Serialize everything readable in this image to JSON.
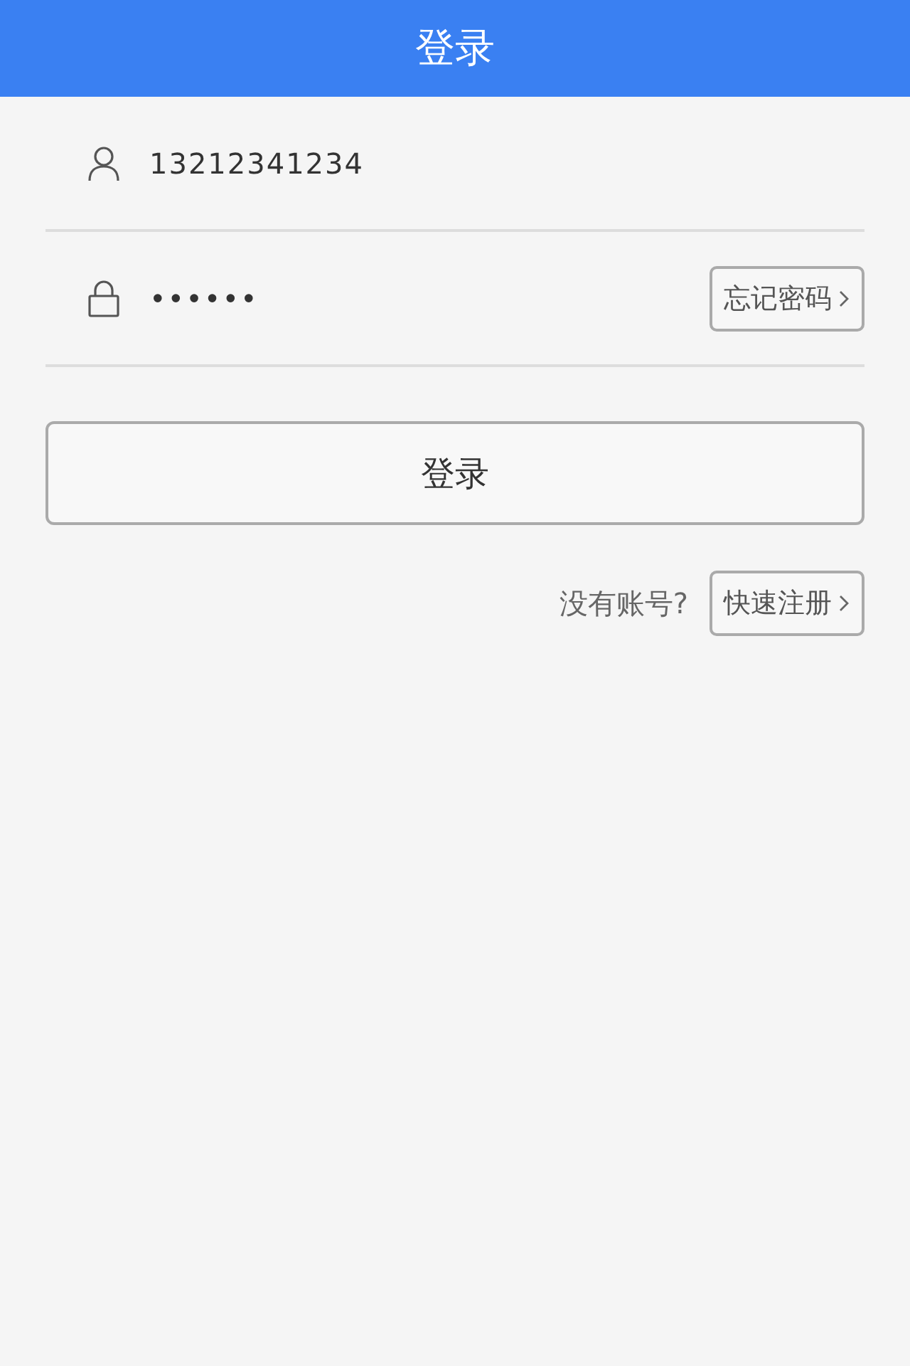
{
  "header": {
    "title": "登录"
  },
  "fields": [
    {
      "kind": "user",
      "value": "13212341234"
    },
    {
      "kind": "password",
      "value": "••••••",
      "action": "忘记密码"
    }
  ],
  "login_button": "登录",
  "register": {
    "prompt": "没有账号?",
    "action": "快速注册"
  }
}
